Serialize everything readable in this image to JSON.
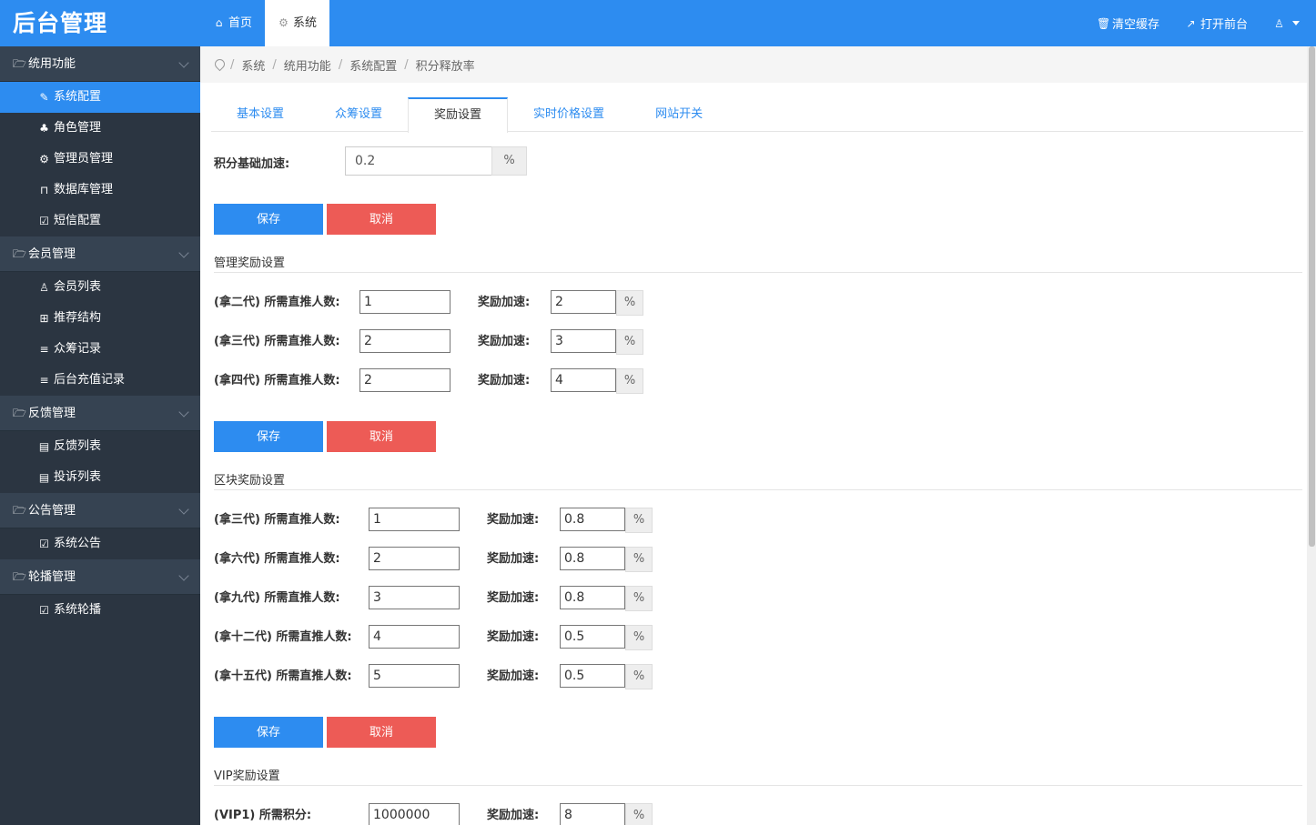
{
  "app": {
    "title": "后台管理"
  },
  "top_tabs": [
    {
      "icon": "home-icon",
      "glyph": "⌂",
      "label": "首页"
    },
    {
      "icon": "gear-icon",
      "glyph": "⚙",
      "label": "系统"
    }
  ],
  "top_right": {
    "clear_cache": "清空缓存",
    "open_front": "打开前台"
  },
  "sidebar": {
    "groups": [
      {
        "label": "统用功能",
        "items": [
          "系统配置",
          "角色管理",
          "管理员管理",
          "数据库管理",
          "短信配置"
        ],
        "icons": [
          "✎",
          "ꔖ",
          "⚙",
          "🔒",
          "☑"
        ]
      },
      {
        "label": "会员管理",
        "items": [
          "会员列表",
          "推荐结构",
          "众筹记录",
          "后台充值记录"
        ],
        "icons": [
          "♙",
          "⊞",
          "≡",
          "≡"
        ]
      },
      {
        "label": "反馈管理",
        "items": [
          "反馈列表",
          "投诉列表"
        ],
        "icons": [
          "▤",
          "▤"
        ]
      },
      {
        "label": "公告管理",
        "items": [
          "系统公告"
        ],
        "icons": [
          "☑"
        ]
      },
      {
        "label": "轮播管理",
        "items": [
          "系统轮播"
        ],
        "icons": [
          "☑"
        ]
      }
    ]
  },
  "breadcrumb": [
    "系统",
    "统用功能",
    "系统配置",
    "积分释放率"
  ],
  "tabs": [
    "基本设置",
    "众筹设置",
    "奖励设置",
    "实时价格设置",
    "网站开关"
  ],
  "base": {
    "label": "积分基础加速:",
    "value": "0.2",
    "unit": "%"
  },
  "buttons": {
    "save": "保存",
    "cancel": "取消"
  },
  "manage_section": {
    "title": "管理奖励设置",
    "speed_label": "奖励加速:",
    "unit": "%",
    "rows": [
      {
        "label": "(拿二代) 所需直推人数:",
        "count": "1",
        "speed": "2"
      },
      {
        "label": "(拿三代) 所需直推人数:",
        "count": "2",
        "speed": "3"
      },
      {
        "label": "(拿四代) 所需直推人数:",
        "count": "2",
        "speed": "4"
      }
    ]
  },
  "block_section": {
    "title": "区块奖励设置",
    "speed_label": "奖励加速:",
    "unit": "%",
    "rows": [
      {
        "label": "(拿三代) 所需直推人数:",
        "count": "1",
        "speed": "0.8"
      },
      {
        "label": "(拿六代) 所需直推人数:",
        "count": "2",
        "speed": "0.8"
      },
      {
        "label": "(拿九代) 所需直推人数:",
        "count": "3",
        "speed": "0.8"
      },
      {
        "label": "(拿十二代) 所需直推人数:",
        "count": "4",
        "speed": "0.5"
      },
      {
        "label": "(拿十五代) 所需直推人数:",
        "count": "5",
        "speed": "0.5"
      }
    ]
  },
  "vip_section": {
    "title": "VIP奖励设置",
    "speed_label": "奖励加速:",
    "unit": "%",
    "rows": [
      {
        "label": "(VIP1) 所需积分:",
        "points": "1000000",
        "speed": "8"
      }
    ]
  },
  "colors": {
    "primary": "#2d8cf0",
    "danger": "#ed5b56",
    "sidebar": "#2b3541",
    "sidebar_group": "#364352"
  }
}
